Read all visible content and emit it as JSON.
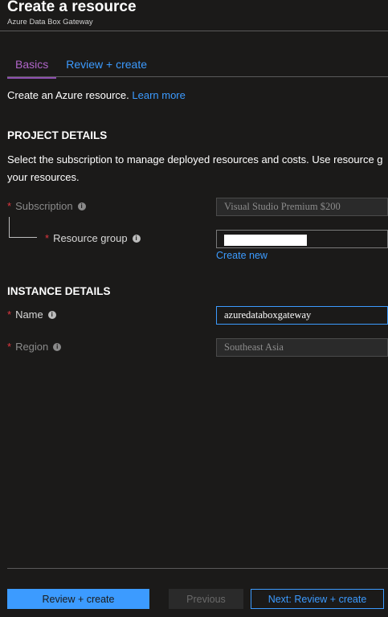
{
  "header": {
    "title": "Create a resource",
    "subtitle": "Azure Data Box Gateway"
  },
  "tabs": [
    {
      "label": "Basics",
      "active": true
    },
    {
      "label": "Review + create",
      "active": false
    }
  ],
  "intro": {
    "text": "Create an Azure resource.",
    "link": "Learn more"
  },
  "project_details": {
    "heading": "PROJECT DETAILS",
    "description_line1": "Select the subscription to manage deployed resources and costs. Use resource g",
    "description_line2": "your resources.",
    "subscription": {
      "label": "Subscription",
      "value": "Visual Studio Premium $200"
    },
    "resource_group": {
      "label": "Resource group",
      "value": "",
      "create_new": "Create new"
    }
  },
  "instance_details": {
    "heading": "INSTANCE DETAILS",
    "name": {
      "label": "Name",
      "value": "azuredataboxgateway"
    },
    "region": {
      "label": "Region",
      "value": "Southeast Asia"
    }
  },
  "footer": {
    "review_create": "Review + create",
    "previous": "Previous",
    "next": "Next: Review + create"
  },
  "colors": {
    "accent": "#3c9bff",
    "active_tab": "#b065c9",
    "required": "#e0373f",
    "background": "#1b1a19"
  },
  "icons": {
    "info": "info-icon"
  }
}
